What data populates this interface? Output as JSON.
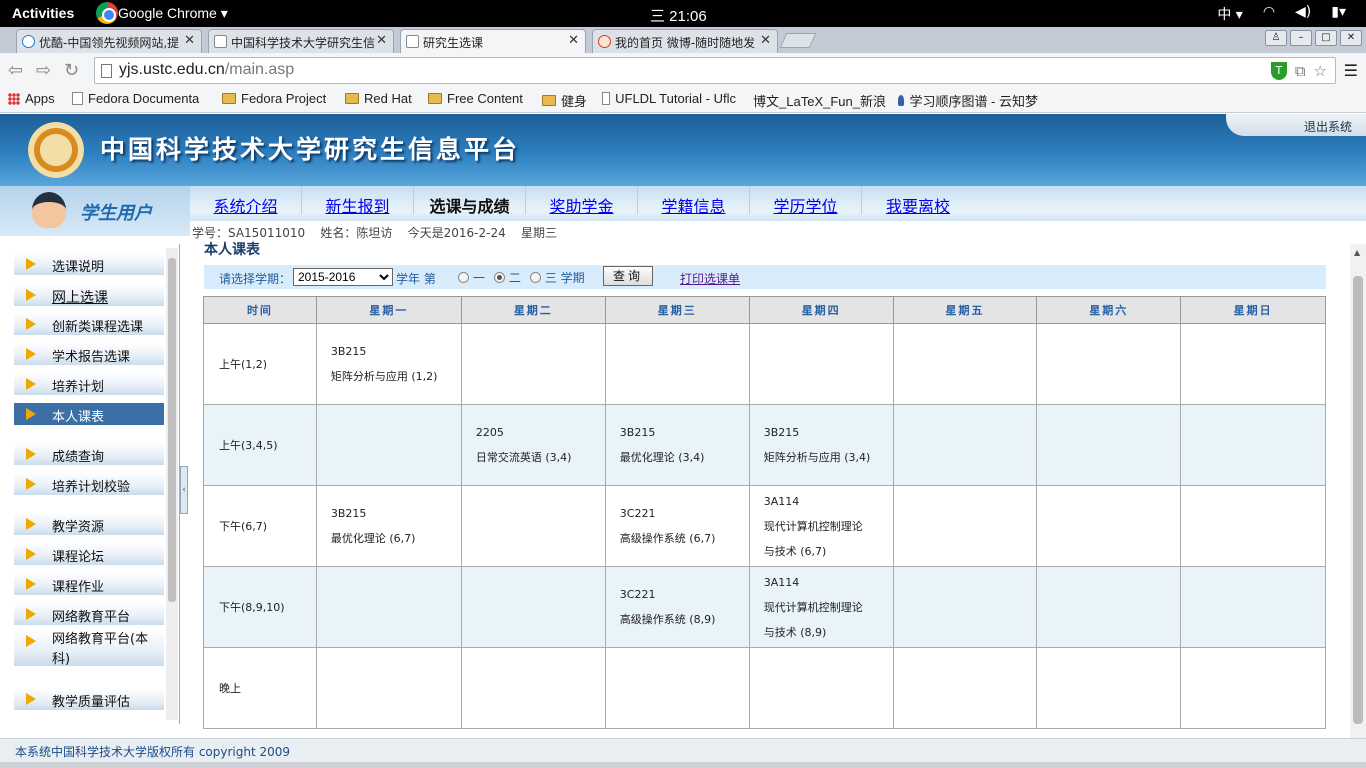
{
  "os": {
    "activities": "Activities",
    "app_name": "Google Chrome ▾",
    "clock": "三 21:06",
    "input_method": "中 ▾"
  },
  "tabs": [
    {
      "label": "优酷-中国领先视频网站,提"
    },
    {
      "label": "中国科学技术大学研究生信"
    },
    {
      "label": "研究生选课"
    },
    {
      "label": "我的首页 微博-随时随地发"
    }
  ],
  "address": {
    "host": "yjs.ustc.edu.cn",
    "path": "/main.asp"
  },
  "bookmarks": [
    "Apps",
    "Fedora Documenta",
    "Fedora Project",
    "Red Hat",
    "Free Content",
    "健身",
    "UFLDL Tutorial - Uflc",
    "博文_LaTeX_Fun_新浪",
    "学习顺序图谱 - 云知梦"
  ],
  "header": {
    "title": "中国科学技术大学研究生信息平台",
    "logout": "退出系统"
  },
  "user": {
    "label": "学生用户"
  },
  "nav": [
    "系统介绍",
    "新生报到",
    "选课与成绩",
    "奖助学金",
    "学籍信息",
    "学历学位",
    "我要离校"
  ],
  "info": "学号：SA15011010    姓名：陈坦访    今天是2016-2-24    星期三",
  "sidebar": [
    "选课说明",
    "网上选课",
    "创新类课程选课",
    "学术报告选课",
    "培养计划",
    "本人课表",
    "成绩查询",
    "培养计划校验",
    "教学资源",
    "课程论坛",
    "课程作业",
    "网络教育平台",
    "网络教育平台(本科)",
    "教学质量评估"
  ],
  "page": {
    "title": "本人课表",
    "term_label": "请选择学期：",
    "year_value": "2015-2016",
    "year_suffix": "学年  第",
    "opt1": "一",
    "opt2": "二",
    "opt3": "三 学期",
    "query_btn": "查询",
    "print_link": "打印选课单"
  },
  "schedule": {
    "headers": [
      "时间",
      "星期一",
      "星期二",
      "星期三",
      "星期四",
      "星期五",
      "星期六",
      "星期日"
    ],
    "rows": [
      {
        "time": "上午(1,2)",
        "cells": [
          "3B215\n矩阵分析与应用 (1,2)",
          "",
          "",
          "",
          "",
          "",
          ""
        ]
      },
      {
        "time": "上午(3,4,5)",
        "cells": [
          "",
          "2205\n日常交流英语 (3,4)",
          "3B215\n最优化理论 (3,4)",
          "3B215\n矩阵分析与应用 (3,4)",
          "",
          "",
          ""
        ]
      },
      {
        "time": "下午(6,7)",
        "cells": [
          "3B215\n最优化理论 (6,7)",
          "",
          "3C221\n高级操作系统 (6,7)",
          "3A114\n现代计算机控制理论\n与技术 (6,7)",
          "",
          "",
          ""
        ]
      },
      {
        "time": "下午(8,9,10)",
        "cells": [
          "",
          "",
          "3C221\n高级操作系统 (8,9)",
          "3A114\n现代计算机控制理论\n与技术 (8,9)",
          "",
          "",
          ""
        ]
      },
      {
        "time": "晚上",
        "cells": [
          "",
          "",
          "",
          "",
          "",
          "",
          ""
        ]
      }
    ]
  },
  "footer": "本系统中国科学技术大学版权所有 copyright 2009"
}
